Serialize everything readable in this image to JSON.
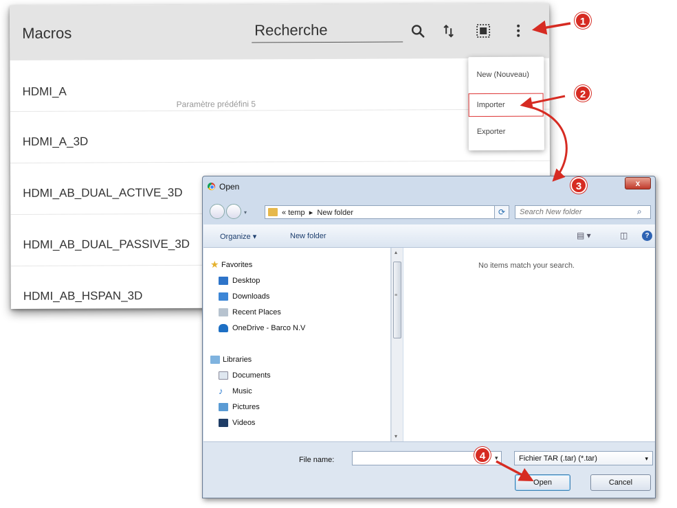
{
  "app": {
    "title": "Macros",
    "search_placeholder": "Recherche",
    "icons": [
      "search-icon",
      "sort-icon",
      "select-all-icon",
      "more-vert-icon"
    ],
    "rows": [
      {
        "title": "HDMI_A",
        "subtitle": "Paramètre prédéfini 5"
      },
      {
        "title": "HDMI_A_3D"
      },
      {
        "title": "HDMI_AB_DUAL_ACTIVE_3D"
      },
      {
        "title": "HDMI_AB_DUAL_PASSIVE_3D"
      },
      {
        "title": "HDMI_AB_HSPAN_3D"
      }
    ]
  },
  "menu": {
    "items": [
      "New (Nouveau)",
      "Importer",
      "Exporter"
    ],
    "highlight_color": "#d33333"
  },
  "dialog": {
    "title": "Open",
    "address": {
      "prefix": "«",
      "segments": [
        "temp",
        "New folder"
      ]
    },
    "search_placeholder": "Search New folder",
    "toolbar": {
      "organize": "Organize ▾",
      "new_folder": "New folder"
    },
    "favorites": {
      "header": "Favorites",
      "items": [
        "Desktop",
        "Downloads",
        "Recent Places",
        "OneDrive - Barco N.V"
      ]
    },
    "libraries": {
      "header": "Libraries",
      "items": [
        "Documents",
        "Music",
        "Pictures",
        "Videos"
      ]
    },
    "empty_message": "No items match your search.",
    "file_name_label": "File name:",
    "file_name_value": "",
    "file_type": "Fichier TAR (.tar) (*.tar)",
    "open_label": "Open",
    "cancel_label": "Cancel",
    "close_label": "x"
  },
  "callouts": [
    "1",
    "2",
    "3",
    "4"
  ],
  "colors": {
    "callout": "#d62b22",
    "header_bg": "#e4e4e4",
    "dialog_frame": "#cfdcec"
  }
}
